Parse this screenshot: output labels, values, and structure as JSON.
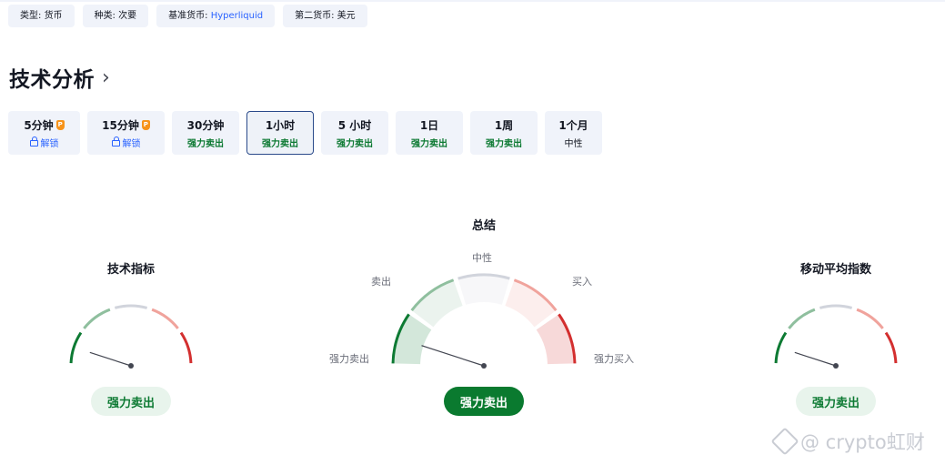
{
  "tags": [
    {
      "label": "类型: ",
      "value": "货币"
    },
    {
      "label": "种类: ",
      "value": "次要"
    },
    {
      "label": "基准货币: ",
      "value": "Hyperliquid"
    },
    {
      "label": "第二货币: ",
      "value": "美元"
    }
  ],
  "section_title": "技术分析",
  "section_chevron": "›",
  "tabs": [
    {
      "label": "5分钟",
      "status": "解锁",
      "locked": true
    },
    {
      "label": "15分钟",
      "status": "解锁",
      "locked": true
    },
    {
      "label": "30分钟",
      "status": "强力卖出"
    },
    {
      "label": "1小时",
      "status": "强力卖出",
      "active": true
    },
    {
      "label": "5 小时",
      "status": "强力卖出"
    },
    {
      "label": "1日",
      "status": "强力卖出"
    },
    {
      "label": "1周",
      "status": "强力卖出"
    },
    {
      "label": "1个月",
      "status": "中性"
    }
  ],
  "premium_badge": "P",
  "gauges": {
    "left": {
      "title": "技术指标",
      "result": "强力卖出"
    },
    "center": {
      "title": "总结",
      "result": "强力卖出",
      "labels": {
        "strong_sell": "强力卖出",
        "sell": "卖出",
        "neutral": "中性",
        "buy": "买入",
        "strong_buy": "强力买入"
      }
    },
    "right": {
      "title": "移动平均指数",
      "result": "强力卖出"
    }
  },
  "watermark": "@ crypto虹财",
  "colors": {
    "strong_sell": "#0d7a33",
    "sell": "#8fbf9e",
    "neutral": "#d1d4dc",
    "buy": "#f0a39c",
    "strong_buy": "#d32f2f"
  }
}
